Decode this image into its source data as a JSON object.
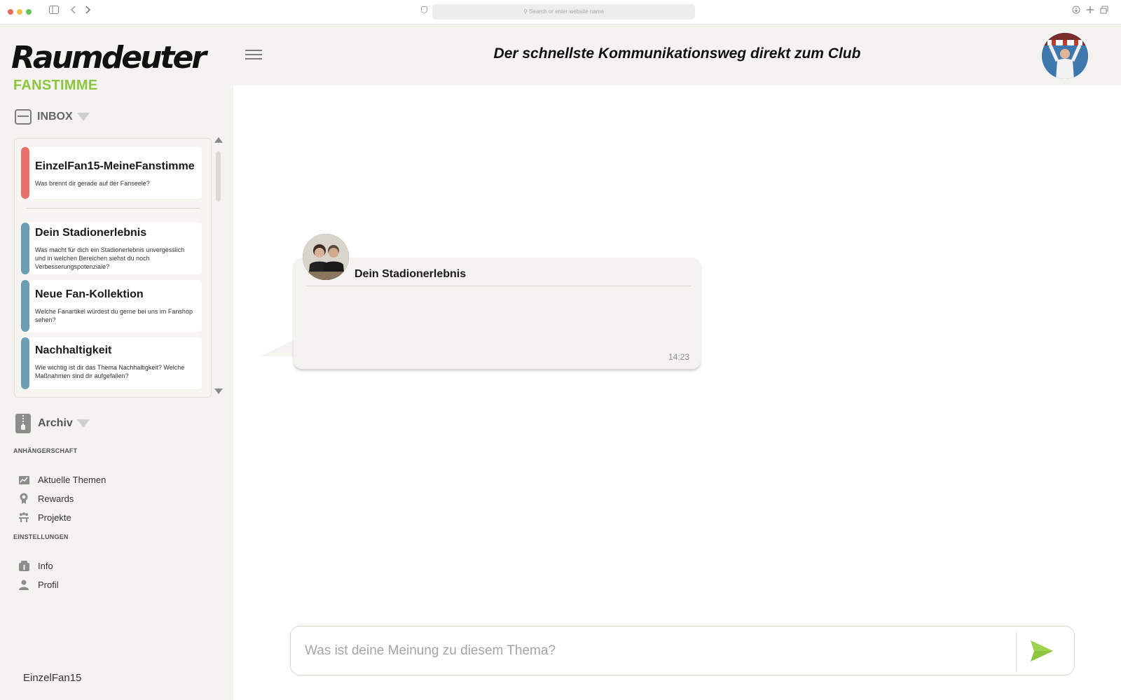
{
  "browser": {
    "url_placeholder": "Search or enter website name"
  },
  "sidebar": {
    "logo": "Raumdeuter",
    "brand_sub": "FANSTIMME",
    "inbox_label": "INBOX",
    "inbox_items": [
      {
        "title": "EinzelFan15-MeineFanstimme",
        "text": "Was brennt dir gerade auf der Fanseele?",
        "accent": "#e8706a"
      },
      {
        "title": "Dein Stadionerlebnis",
        "text": "Was macht für dich ein Stadionerlebnis unvergesslich und in welchen Bereichen siehst du noch Verbesserungspotenziale?",
        "accent": "#6b9db5"
      },
      {
        "title": "Neue Fan-Kollektion",
        "text": "Welche Fanartikel würdest du gerne bei uns im Fanshop sehen?",
        "accent": "#6b9db5"
      },
      {
        "title": "Nachhaltigkeit",
        "text": "Wie wichtig ist dir das Thema Nachhaltigkeit? Welche Maßnahmen sind dir aufgefallen?",
        "accent": "#6b9db5"
      }
    ],
    "archiv_label": "Archiv",
    "sections": [
      {
        "label": "ANHÄNGERSCHAFT",
        "items": [
          {
            "label": "Aktuelle Themen",
            "icon": "chart-icon"
          },
          {
            "label": "Rewards",
            "icon": "award-icon"
          },
          {
            "label": "Projekte",
            "icon": "projects-icon"
          }
        ]
      },
      {
        "label": "EINSTELLUNGEN",
        "items": [
          {
            "label": "Info",
            "icon": "info-icon"
          },
          {
            "label": "Profil",
            "icon": "profile-icon"
          }
        ]
      }
    ],
    "username": "EinzelFan15"
  },
  "header": {
    "title": "Der schnellste Kommunikationsweg direkt zum Club"
  },
  "chat": {
    "message": {
      "title": "Dein Stadionerlebnis",
      "time": "14:23"
    },
    "composer": {
      "placeholder": "Was ist deine Meinung zu diesem Thema?"
    }
  },
  "colors": {
    "brand_green": "#8cc63f",
    "sidebar_bg": "#f5f3ef",
    "alert_red": "#e8706a",
    "topic_blue": "#6b9db5"
  }
}
